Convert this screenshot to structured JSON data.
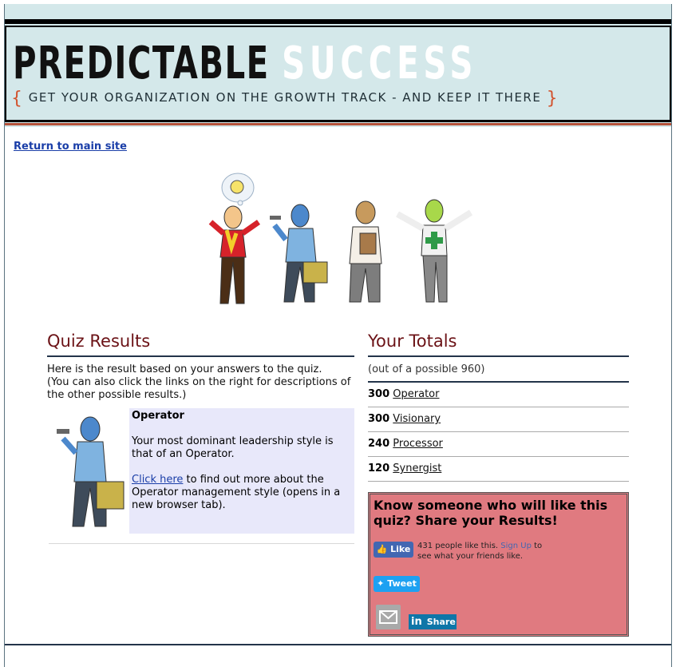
{
  "banner": {
    "title_part1": "PREDICTABLE",
    "title_part2": "SUCCESS",
    "tagline_open": "{",
    "tagline": "GET YOUR ORGANIZATION ON THE GROWTH TRACK - AND KEEP IT THERE",
    "tagline_close": "}"
  },
  "nav": {
    "return_link": "Return to main site"
  },
  "quiz_results": {
    "heading": "Quiz Results",
    "intro_line1": "Here is the result based on your answers to the quiz.",
    "intro_line2": "(You can also click the links on the right for descriptions of the other possible results.)",
    "result_title": "Operator",
    "result_text": "Your most dominant leadership style is that of an Operator.",
    "click_link": "Click here",
    "click_rest": " to find out more about the Operator management style (opens in a new browser tab)."
  },
  "totals": {
    "heading": "Your Totals",
    "subtitle": "(out of a possible 960)",
    "rows": [
      {
        "score": "300",
        "label": "Operator"
      },
      {
        "score": "300",
        "label": "Visionary"
      },
      {
        "score": "240",
        "label": "Processor"
      },
      {
        "score": "120",
        "label": "Synergist"
      }
    ]
  },
  "share": {
    "heading": "Know someone who will like this quiz? Share your Results!",
    "like_label": "Like",
    "like_text_pre": "431 people like this. ",
    "like_signup": "Sign Up",
    "like_text_post": " to see what your friends like.",
    "tweet_label": "Tweet",
    "linkedin_label": "Share"
  },
  "colors": {
    "banner_bg": "#d4e8ea",
    "heading": "#6b1216",
    "share_bg": "#e07a80",
    "link": "#1a3ea8"
  },
  "icons": [
    "facebook-like-icon",
    "twitter-icon",
    "email-icon",
    "linkedin-icon"
  ]
}
